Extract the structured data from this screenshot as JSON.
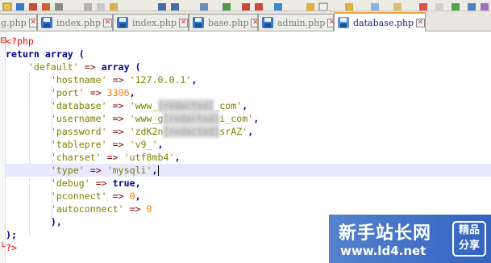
{
  "tabs": [
    {
      "label": "g.php",
      "active": false
    },
    {
      "label": "index.php",
      "active": false
    },
    {
      "label": "index.php",
      "active": false
    },
    {
      "label": "base.php",
      "active": false
    },
    {
      "label": "admin.php",
      "active": false
    },
    {
      "label": "database.php",
      "active": true
    }
  ],
  "code": {
    "open_tag": "<?php",
    "return_kw": "return",
    "array_kw": "array",
    "default_key": "'default'",
    "arrow": "=>",
    "entries": [
      {
        "key": "'hostname'",
        "value": "'127.0.0.1'",
        "kind": "str"
      },
      {
        "key": "'port'",
        "value": "3306",
        "kind": "num"
      },
      {
        "key": "'database'",
        "value_pre": "'www_",
        "value_masked": "[redacted]",
        "value_post": "_com'",
        "kind": "masked"
      },
      {
        "key": "'username'",
        "value_pre": "'www_g",
        "value_masked": "[redacted]",
        "value_post": "i_com'",
        "kind": "masked"
      },
      {
        "key": "'password'",
        "value_pre": "'zdK2n",
        "value_masked": "[redacted]",
        "value_post": "srAZ'",
        "kind": "masked"
      },
      {
        "key": "'tablepre'",
        "value": "'v9_'",
        "kind": "str"
      },
      {
        "key": "'charset'",
        "value": "'utf8mb4'",
        "kind": "str"
      },
      {
        "key": "'type'",
        "value": "'mysqli'",
        "kind": "str"
      },
      {
        "key": "'debug'",
        "value": "true",
        "kind": "kw"
      },
      {
        "key": "'pconnect'",
        "value": "0",
        "kind": "num"
      },
      {
        "key": "'autoconnect'",
        "value": "0",
        "kind": "num"
      }
    ],
    "close_inner": "),",
    "close_outer": ");",
    "close_tag": "?>"
  },
  "watermark": {
    "title": "新手站长网",
    "url": "www.ld4.net",
    "badge_line1": "精品",
    "badge_line2": "分享"
  },
  "colors": {
    "keyword": "#00008b",
    "string": "#808000",
    "number": "#ff8000",
    "php_tag": "#ff0000",
    "current_line": "#e8e8ff",
    "active_tab_accent": "#f2a33a"
  }
}
